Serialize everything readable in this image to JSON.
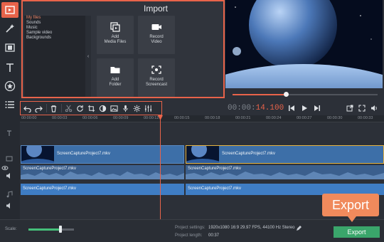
{
  "import": {
    "title": "Import",
    "categories": [
      "My files",
      "Sounds",
      "Music",
      "Sample video",
      "Backgrounds"
    ],
    "tiles": [
      {
        "label": "Add\nMedia Files",
        "icon": "media-files-icon"
      },
      {
        "label": "Record\nVideo",
        "icon": "camera-icon"
      },
      {
        "label": "Add\nFolder",
        "icon": "folder-icon"
      },
      {
        "label": "Record\nScreencast",
        "icon": "screencast-icon"
      }
    ]
  },
  "player": {
    "timecode_main": "00:00:",
    "timecode_frac": "14.100",
    "progress": 0.37
  },
  "timeline": {
    "ticks": [
      "00:00:00",
      "00:00:03",
      "00:00:06",
      "00:00:09",
      "00:00:12",
      "00:00:15",
      "00:00:18",
      "00:00:21",
      "00:00:24",
      "00:00:27",
      "00:00:30",
      "00:00:33"
    ],
    "video_clip_1": "ScreenCaptureProject7.mkv",
    "video_clip_2": "ScreenCaptureProject7.mkv",
    "audio_clip_1": "ScreenCaptureProject7.mkv",
    "audio_clip_2": "ScreenCaptureProject7.mkv",
    "music_clip_1": "ScreenCaptureProject7.mkv",
    "music_clip_2": "ScreenCaptureProject7.mkv"
  },
  "bottom": {
    "scale_label": "Scale:",
    "project_settings_label": "Project settings:",
    "project_settings_value": "1920x1080 16:9 29.97 FPS, 44100 Hz Stereo",
    "project_length_label": "Project length:",
    "project_length_value": "00:37",
    "export_label": "Export",
    "scale_level": 0.7
  },
  "callout": {
    "label": "Export"
  },
  "colors": {
    "accent": "#e8634a",
    "export": "#3aa66b",
    "callout": "#f08a5c"
  }
}
